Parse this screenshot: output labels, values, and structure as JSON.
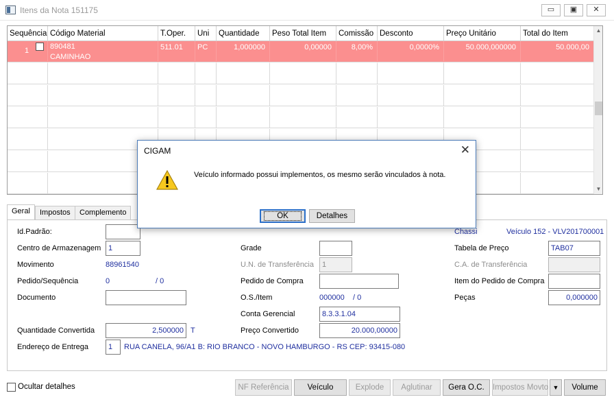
{
  "window": {
    "title": "Itens da Nota 151175",
    "min_glyph": "▭",
    "max_glyph": "▣",
    "close_glyph": "✕"
  },
  "grid": {
    "columns": [
      "Sequência",
      "Código Material",
      "T.Oper.",
      "Uni",
      "Quantidade",
      "Peso Total Item",
      "Comissão",
      "Desconto",
      "Preço Unitário",
      "Total do Item"
    ],
    "selected_row": {
      "sequencia": "1",
      "codigo": "890481",
      "descricao": "CAMINHAO",
      "t_oper": "511.01",
      "uni": "PC",
      "quantidade": "1,000000",
      "peso": "0,00000",
      "comissao": "8,00%",
      "desconto": "0,0000%",
      "preco_unitario": "50.000,000000",
      "total": "50.000,00"
    },
    "selected_color": "#fb8f8f"
  },
  "tabs": [
    "Geral",
    "Impostos",
    "Complemento"
  ],
  "form": {
    "id_padrao": {
      "label": "Id.Padrão:",
      "value": ""
    },
    "centro": {
      "label": "Centro de Armazenagem",
      "value": "1"
    },
    "movimento": {
      "label": "Movimento",
      "value": "88961540"
    },
    "pedido_seq": {
      "label": "Pedido/Sequência",
      "value": "0",
      "seq": "/ 0"
    },
    "documento": {
      "label": "Documento",
      "value": ""
    },
    "qtd_convertida": {
      "label": "Quantidade Convertida",
      "value": "2,500000",
      "unit": "T"
    },
    "endereco": {
      "label": "Endereço de Entrega",
      "value": "1",
      "text": "RUA CANELA, 96/A1 B: RIO BRANCO - NOVO HAMBURGO - RS CEP: 93415-080"
    },
    "grade": {
      "label": "Grade",
      "value": ""
    },
    "un_transf": {
      "label": "U.N. de Transferência",
      "value": "1"
    },
    "pedido_compra": {
      "label": "Pedido de Compra",
      "value": ""
    },
    "os_item": {
      "label": "O.S./Item",
      "value": "000000",
      "item": "/ 0"
    },
    "conta_gerencial": {
      "label": "Conta Gerencial",
      "value": "8.3.3.1.04"
    },
    "preco_convertido": {
      "label": "Preço Convertido",
      "value": "20.000,00000"
    },
    "chassi": {
      "label": "Chassi",
      "value": "Veículo 152 - VLV201700001"
    },
    "tabela_preco": {
      "label": "Tabela de Preço",
      "value": "TAB07"
    },
    "ca_transf": {
      "label": "C.A. de Transferência",
      "value": ""
    },
    "item_pedido_compra": {
      "label": "Item do Pedido de Compra",
      "value": ""
    },
    "pecas": {
      "label": "Peças",
      "value": "0,000000"
    }
  },
  "footer": {
    "ocultar_label": "Ocultar detalhes",
    "buttons": {
      "nf_referencia": "NF Referência",
      "veiculo": "Veículo",
      "explode": "Explode",
      "aglutinar": "Aglutinar",
      "gera_oc": "Gera O.C.",
      "impostos_movto": "Impostos Movto",
      "dropdown": "▼",
      "volume": "Volume"
    }
  },
  "dialog": {
    "title": "CIGAM",
    "close_glyph": "✕",
    "message": "Veículo informado possui implementos, os mesmo serão vinculados à nota.",
    "ok_label": "OK",
    "details_label": "Detalhes",
    "icon": "warning-icon"
  }
}
